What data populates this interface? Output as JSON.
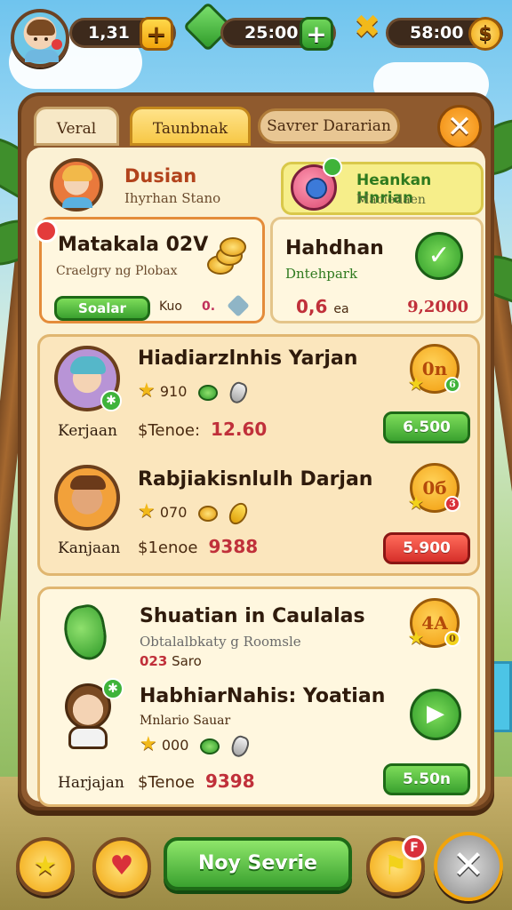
{
  "hud": {
    "resource1": "1,31",
    "resource2": "25:00",
    "resource3": "58:00",
    "plus_label": "+"
  },
  "tabs": [
    "Veral",
    "Taunbnak",
    "Savrer Dararian"
  ],
  "close_label": "✕",
  "profile": {
    "name": "Dusian",
    "subtitle": "Ihyrhan Stano"
  },
  "promo": {
    "title": "Heankan Hnrian",
    "subtitle": "Maciedaen"
  },
  "card1": {
    "title": "Matakala 02V",
    "subtitle": "Craelgry ng Plobax",
    "button": "Soalar",
    "note": "Kuo",
    "zero": "0."
  },
  "card2": {
    "title": "Hahdhan",
    "subtitle": "Dntehpark",
    "price": "0,6",
    "price_unit": "ea",
    "value": "9,2000",
    "check": "✓"
  },
  "rows": [
    {
      "title": "Hiadiarzlnhis Yarjan",
      "stars": "910",
      "name": "Kerjaan",
      "trade_label": "$Tenoe:",
      "price": "12.60",
      "badge": "0n",
      "button": "6.500"
    },
    {
      "title": "Rabjiakisnlulh Darjan",
      "stars": "070",
      "name": "Kanjaan",
      "trade_label": "$1enoe",
      "price": "9388",
      "badge": "0б",
      "button": "5.900"
    }
  ],
  "group2": {
    "title": "Shuatian in Caulalas",
    "sub1": "Obtalalbkaty g Roomsle",
    "sub2_num": "023",
    "sub2_text": "Saro",
    "badge": "4A",
    "row_title": "HabhiarNahis: Yoatian",
    "row_sub": "Mnlario Sauar",
    "stars": "000",
    "name": "Harjajan",
    "trade_label": "$Tenoe",
    "price": "9398",
    "button": "5.50n"
  },
  "bottom": {
    "main_button": "Noy Sevrie",
    "flag_notif": "F",
    "close": "✕"
  },
  "colors": {
    "accent_green": "#3aa12f",
    "accent_red": "#d62f2a",
    "panel_brown": "#8f5a2e",
    "panel_cream": "#fbf1d4"
  }
}
